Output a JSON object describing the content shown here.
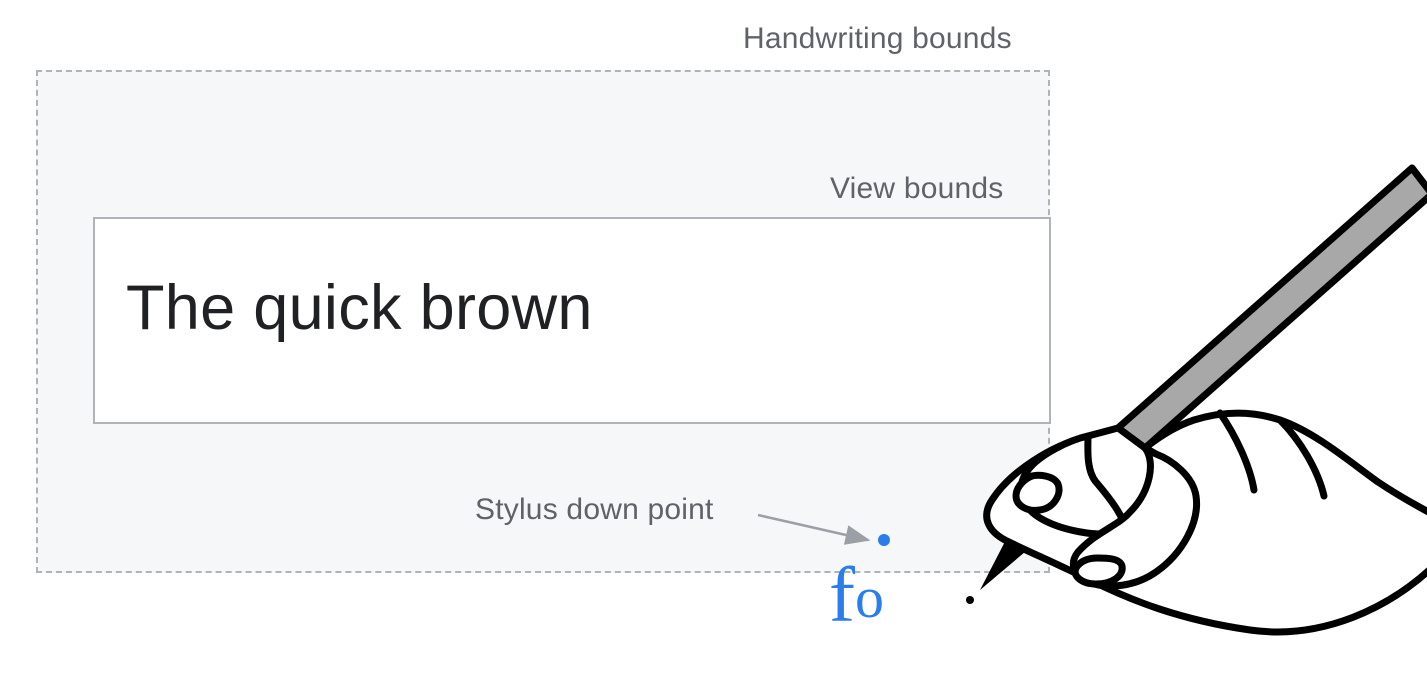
{
  "labels": {
    "handwriting_bounds": "Handwriting bounds",
    "view_bounds": "View bounds",
    "stylus_down": "Stylus down point"
  },
  "text_input": {
    "value": "The quick brown"
  },
  "handwriting_glyph": {
    "first": "f",
    "second": "o"
  },
  "colors": {
    "ink": "#2b7de9",
    "label": "#5f6368",
    "border": "#b0b3b8",
    "bounds_fill": "#f6f7f8",
    "text": "#202124",
    "pen_fill": "#a8a8a8"
  }
}
